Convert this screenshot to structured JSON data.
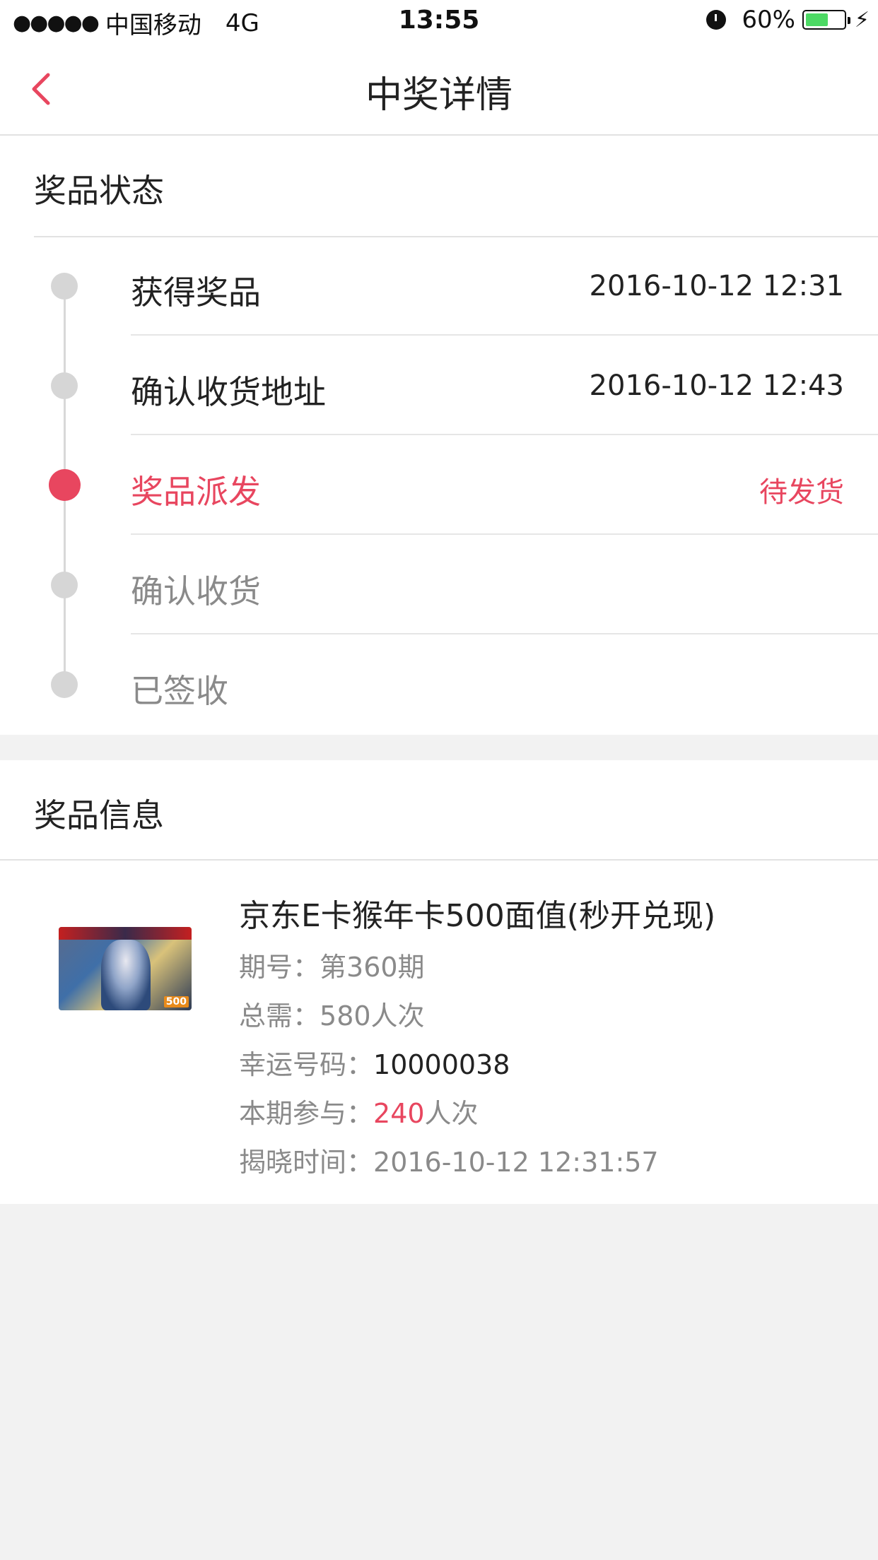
{
  "status_bar": {
    "signal": "●●●●●",
    "carrier": "中国移动",
    "network": "4G",
    "time": "13:55",
    "battery": "60%",
    "battery_level": 0.6
  },
  "nav": {
    "title": "中奖详情",
    "back_icon": "chevron-left-icon"
  },
  "prize_status": {
    "title": "奖品状态",
    "steps": [
      {
        "label": "获得奖品",
        "time": "2016-10-12 12:31"
      },
      {
        "label": "确认收货地址",
        "time": "2016-10-12 12:43"
      },
      {
        "label": "奖品派发",
        "time": "待发货"
      },
      {
        "label": "确认收货",
        "time": ""
      },
      {
        "label": "已签收",
        "time": ""
      }
    ]
  },
  "prize_info": {
    "title": "奖品信息",
    "name": "京东E卡猴年卡500面值(秒开兑现)",
    "period_label": "期号：",
    "period_value": "第360期",
    "total_label": "总需：",
    "total_value": "580人次",
    "lucky_label": "幸运号码：",
    "lucky_value": "10000038",
    "join_label": "本期参与：",
    "join_count": "240",
    "join_unit": "人次",
    "reveal_label": "揭晓时间：",
    "reveal_value": "2016-10-12 12:31:57",
    "image_badge": "500"
  },
  "colors": {
    "accent": "#e8465f",
    "muted": "#8a8a8a",
    "background": "#f2f2f2"
  }
}
